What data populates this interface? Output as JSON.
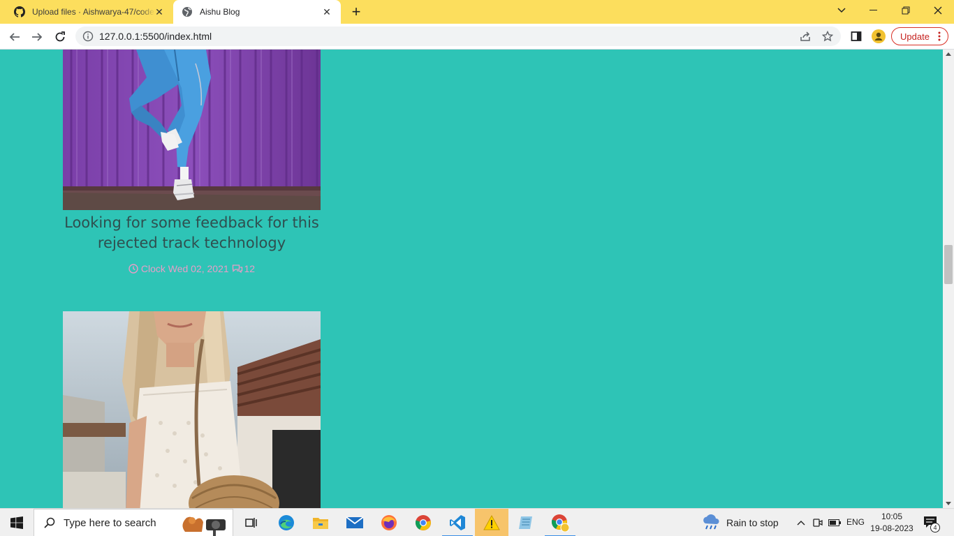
{
  "browser": {
    "tabs": [
      {
        "title": "Upload files · Aishwarya-47/code",
        "icon": "github-icon",
        "active": false
      },
      {
        "title": "Aishu Blog",
        "icon": "globe-icon",
        "active": true
      }
    ],
    "address": "127.0.0.1:5500/index.html",
    "update_label": "Update"
  },
  "page": {
    "background_color": "#2ec4b6",
    "posts": [
      {
        "title": "Looking for some feedback for this rejected track technology",
        "meta_date": "Clock Wed 02, 2021",
        "meta_comments": "12",
        "image": "photo-jeans-purple-wall"
      },
      {
        "image": "photo-woman-white-dress"
      }
    ]
  },
  "taskbar": {
    "search_placeholder": "Type here to search",
    "apps": [
      "task-view-icon",
      "edge-icon",
      "file-explorer-icon",
      "mail-icon",
      "firefox-icon",
      "chrome-icon",
      "vscode-icon",
      "warning-app-icon",
      "notepad-icon",
      "chrome-profile-icon"
    ],
    "weather": "Rain to stop",
    "language": "ENG",
    "time": "10:05",
    "date": "19-08-2023",
    "notification_count": "4"
  },
  "colors": {
    "tab_strip": "#fcde5d",
    "meta_pink": "#e89ec7",
    "title_text": "#2f4f4f",
    "update_red": "#d93025"
  }
}
